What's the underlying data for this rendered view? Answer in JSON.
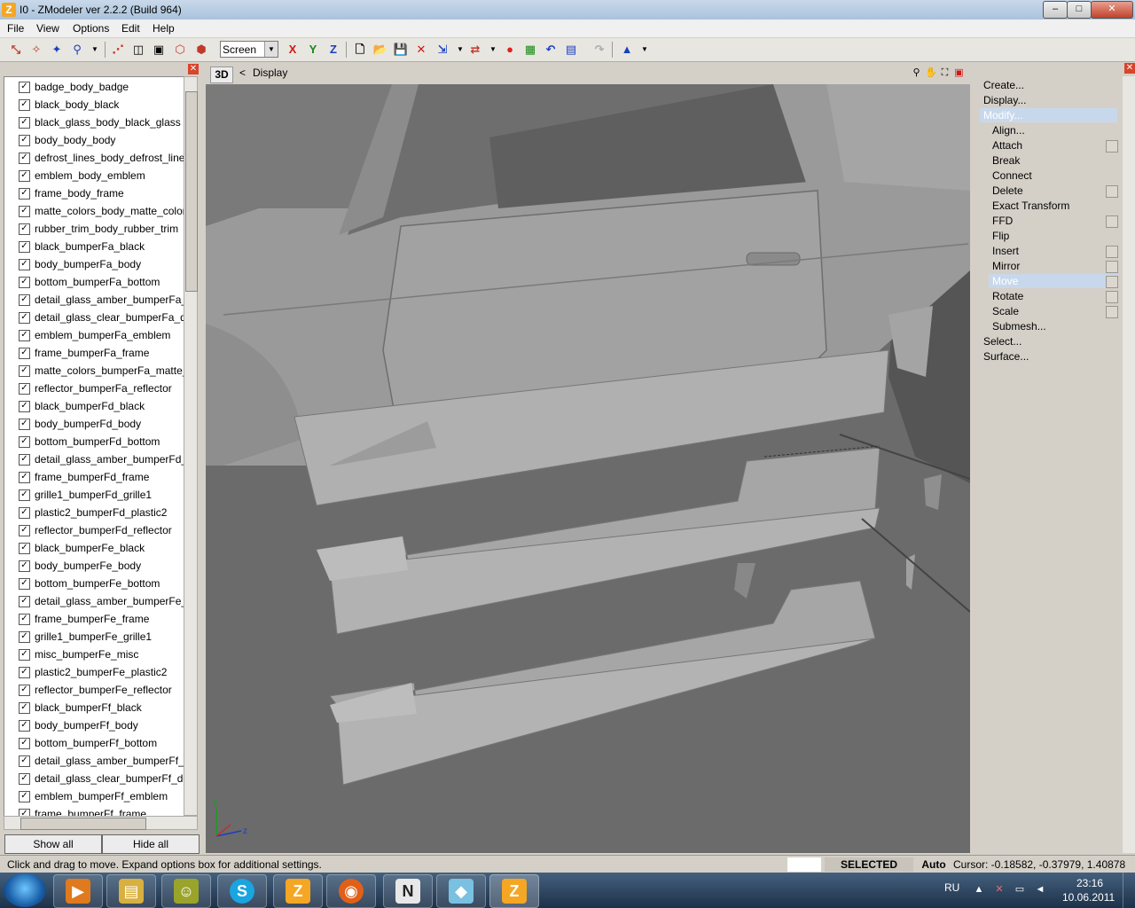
{
  "window": {
    "title": "I0 - ZModeler ver 2.2.2 (Build 964)",
    "icon": "Z",
    "controls": {
      "minimize": "–",
      "maximize": "□",
      "close": "✕"
    }
  },
  "menu": [
    "File",
    "View",
    "Options",
    "Edit",
    "Help"
  ],
  "toolbar": {
    "screen_mode": "Screen",
    "axes": [
      {
        "label": "X",
        "color": "#d01818"
      },
      {
        "label": "Y",
        "color": "#148a14"
      },
      {
        "label": "Z",
        "color": "#1a3fbf"
      }
    ]
  },
  "left_panel": {
    "close": "✕",
    "items": [
      "badge_body_badge",
      "black_body_black",
      "black_glass_body_black_glass",
      "body_body_body",
      "defrost_lines_body_defrost_lines",
      "emblem_body_emblem",
      "frame_body_frame",
      "matte_colors_body_matte_colors",
      "rubber_trim_body_rubber_trim",
      "black_bumperFa_black",
      "body_bumperFa_body",
      "bottom_bumperFa_bottom",
      "detail_glass_amber_bumperFa_detail_glass_amber",
      "detail_glass_clear_bumperFa_detail_glass_clear",
      "emblem_bumperFa_emblem",
      "frame_bumperFa_frame",
      "matte_colors_bumperFa_matte_colors",
      "reflector_bumperFa_reflector",
      "black_bumperFd_black",
      "body_bumperFd_body",
      "bottom_bumperFd_bottom",
      "detail_glass_amber_bumperFd_detail_glass_amber",
      "frame_bumperFd_frame",
      "grille1_bumperFd_grille1",
      "plastic2_bumperFd_plastic2",
      "reflector_bumperFd_reflector",
      "black_bumperFe_black",
      "body_bumperFe_body",
      "bottom_bumperFe_bottom",
      "detail_glass_amber_bumperFe_detail_glass_amber",
      "frame_bumperFe_frame",
      "grille1_bumperFe_grille1",
      "misc_bumperFe_misc",
      "plastic2_bumperFe_plastic2",
      "reflector_bumperFe_reflector",
      "black_bumperFf_black",
      "body_bumperFf_body",
      "bottom_bumperFf_bottom",
      "detail_glass_amber_bumperFf_detail_glass_amber",
      "detail_glass_clear_bumperFf_detail_glass_clear",
      "emblem_bumperFf_emblem",
      "frame_bumperFf_frame"
    ],
    "buttons": {
      "show_all": "Show all",
      "hide_all": "Hide all"
    }
  },
  "viewport": {
    "mode": "3D",
    "back": "<",
    "label": "Display",
    "axes": {
      "y": "y",
      "z": "z"
    }
  },
  "right_panel": {
    "close": "✕",
    "top_commands": [
      "Create...",
      "Display...",
      "Modify..."
    ],
    "modify_commands": [
      {
        "label": "Align...",
        "options": false
      },
      {
        "label": "Attach",
        "options": true
      },
      {
        "label": "Break",
        "options": false
      },
      {
        "label": "Connect",
        "options": false
      },
      {
        "label": "Delete",
        "options": true
      },
      {
        "label": "Exact Transform",
        "options": false
      },
      {
        "label": "FFD",
        "options": true
      },
      {
        "label": "Flip",
        "options": false
      },
      {
        "label": "Insert",
        "options": true
      },
      {
        "label": "Mirror",
        "options": true
      },
      {
        "label": "Move",
        "options": true,
        "selected": true
      },
      {
        "label": "Rotate",
        "options": true
      },
      {
        "label": "Scale",
        "options": true
      },
      {
        "label": "Submesh...",
        "options": false
      }
    ],
    "bottom_commands": [
      "Select...",
      "Surface..."
    ]
  },
  "status": {
    "hint": "Click and drag to move. Expand options box for additional settings.",
    "mode": "SELECTED MODE",
    "auto": "Auto",
    "cursor": "Cursor: -0.18582, -0.37979, 1.40878"
  },
  "taskbar": {
    "lang": "RU",
    "time": "23:16",
    "date": "10.06.2011"
  }
}
